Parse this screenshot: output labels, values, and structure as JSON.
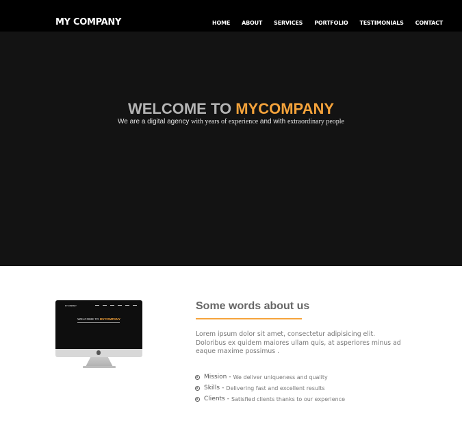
{
  "header": {
    "brand": "MY COMPANY",
    "nav": [
      "HOME",
      "ABOUT",
      "SERVICES",
      "PORTFOLIO",
      "TESTIMONIALS",
      "CONTACT"
    ]
  },
  "hero": {
    "title_muted": "WELCOME TO ",
    "title_accent": "MYCOMPANY",
    "subtitle_part1": "We are a digital agency ",
    "subtitle_part2": "with years of experience",
    "subtitle_part3": " and with ",
    "subtitle_part4": "extraordinary people"
  },
  "about": {
    "title": "Some words about us",
    "text": "Lorem ipsum dolor sit amet, consectetur adipisicing elit. Doloribus ex quidem maiores ullam quis, at asperiores minus ad eaque maxime possimus .",
    "features": [
      {
        "name": "Mission",
        "desc": "We deliver uniqueness and quality"
      },
      {
        "name": "Skills",
        "desc": "Delivering fast and excellent results"
      },
      {
        "name": "Clients",
        "desc": "Satisfied clients thanks to our experience"
      }
    ],
    "feature_separator": "-",
    "monitor_screen": {
      "brand": "MY COMPANY",
      "title_muted": "WELCOME TO ",
      "title_accent": "MYCOMPANY"
    }
  },
  "colors": {
    "accent": "#f5a33b",
    "navbar": "#000000",
    "hero_bg": "#131313"
  },
  "icons": {
    "feature_bullet": "circle-dot-icon",
    "monitor_logo": "apple-icon"
  }
}
